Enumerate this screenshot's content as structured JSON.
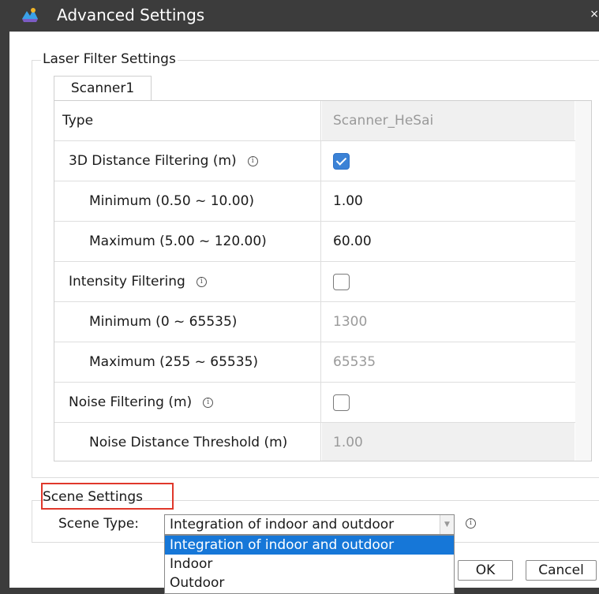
{
  "window": {
    "title": "Advanced Settings",
    "close_glyph": "×"
  },
  "laser_filter": {
    "group_title": "Laser Filter Settings",
    "tab": "Scanner1",
    "rows": [
      {
        "label": "Type",
        "value": "Scanner_HeSai"
      },
      {
        "label": "3D Distance Filtering (m)",
        "checked": true
      },
      {
        "label": "Minimum (0.50 ~ 10.00)",
        "value": "1.00"
      },
      {
        "label": "Maximum (5.00 ~ 120.00)",
        "value": "60.00"
      },
      {
        "label": "Intensity Filtering",
        "checked": false
      },
      {
        "label": "Minimum (0 ~ 65535)",
        "value": "1300"
      },
      {
        "label": "Maximum (255 ~ 65535)",
        "value": "65535"
      },
      {
        "label": "Noise Filtering (m)",
        "checked": false
      },
      {
        "label": "Noise Distance Threshold (m)",
        "value": "1.00"
      }
    ]
  },
  "scene": {
    "group_title": "Scene Settings",
    "type_label": "Scene Type:",
    "selected": "Integration of indoor and outdoor",
    "options": [
      "Integration of indoor and outdoor",
      "Indoor",
      "Outdoor"
    ]
  },
  "buttons": {
    "ok": "OK",
    "cancel": "Cancel"
  },
  "icons": {
    "info": "info-icon",
    "info_glyph": "i",
    "dropdown_arrow": "▼"
  },
  "colors": {
    "titlebar": "#3c3c3c",
    "selection": "#1677d8",
    "checkbox_checked": "#3b82d6",
    "highlight": "#e0382b"
  }
}
